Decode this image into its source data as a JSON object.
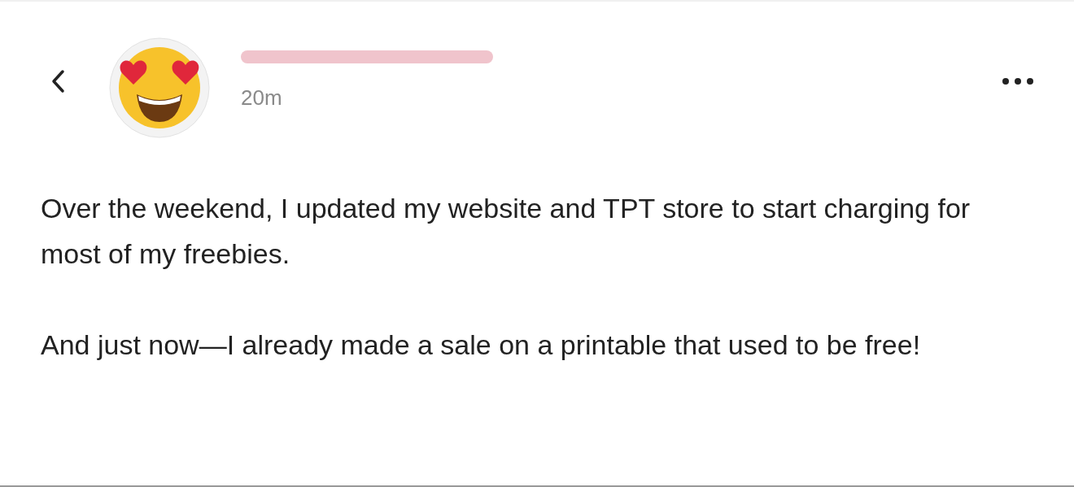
{
  "post": {
    "author": {
      "redacted": true
    },
    "time": "20m",
    "paragraphs": [
      "Over the weekend, I updated my website and TPT store to start charging for most of my freebies.",
      "And just now—I already made a sale on a printable that used to be free!"
    ]
  }
}
